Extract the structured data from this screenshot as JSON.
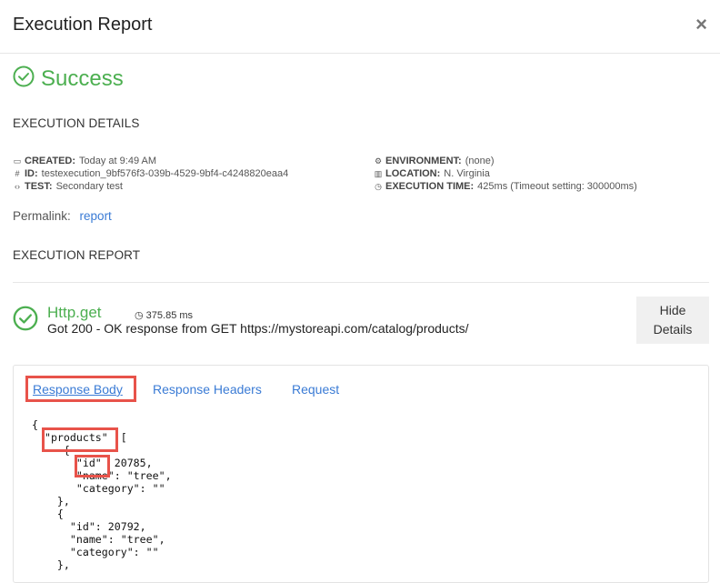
{
  "header": {
    "title": "Execution Report",
    "close": "×"
  },
  "status": {
    "text": "Success",
    "color": "#4caf50",
    "icon": "check-circle-icon"
  },
  "details": {
    "heading": "EXECUTION DETAILS",
    "created_label": "CREATED:",
    "created_value": "Today at 9:49 AM",
    "id_label": "ID:",
    "id_value": "testexecution_9bf576f3-039b-4529-9bf4-c4248820eaa4",
    "test_label": "TEST:",
    "test_value": "Secondary test",
    "environment_label": "ENVIRONMENT:",
    "environment_value": "(none)",
    "location_label": "LOCATION:",
    "location_value": "N. Virginia",
    "exectime_label": "EXECUTION TIME:",
    "exectime_value": "425ms (Timeout setting: 300000ms)"
  },
  "permalink": {
    "label": "Permalink:",
    "link": "report"
  },
  "report": {
    "heading": "EXECUTION REPORT",
    "step_name": "Http.get",
    "step_time": "375.85 ms",
    "step_message": "Got 200 - OK response from GET https://mystoreapi.com/catalog/products/",
    "hide_button_line1": "Hide",
    "hide_button_line2": "Details"
  },
  "tabs": [
    "Response Body",
    "Response Headers",
    "Request"
  ],
  "response_body": "{\n  \"products\"  [\n     {\n       \"id\"  20785,\n       \"name\": \"tree\",\n       \"category\": \"\"\n    },\n    {\n      \"id\": 20792,\n      \"name\": \"tree\",\n      \"category\": \"\"\n    },"
}
